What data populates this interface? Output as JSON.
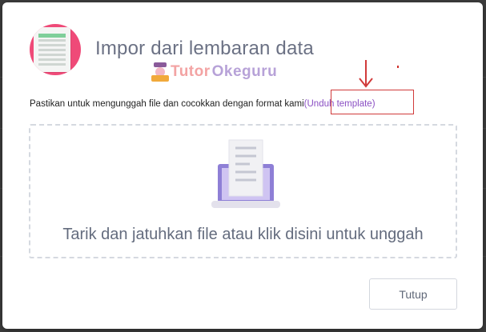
{
  "dialog": {
    "title": "Impor dari lembaran data",
    "instruction": "Pastikan untuk mengunggah file dan cocokkan dengan format kami",
    "link_label": "(Unduh template)",
    "dropzone_text": "Tarik dan jatuhkan file atau klik disini untuk unggah",
    "close_label": "Tutup"
  },
  "watermark": {
    "part1": "Tutor",
    "part2": "Okeguru"
  },
  "icons": {
    "header": "spreadsheet-icon",
    "dropzone": "laptop-document-icon",
    "annotation": "red-arrow-annotation"
  },
  "colors": {
    "link": "#8a4fc3",
    "icon_circle": "#ef4a78",
    "laptop": "#8e7fd6",
    "annotation": "#d13a3a"
  }
}
